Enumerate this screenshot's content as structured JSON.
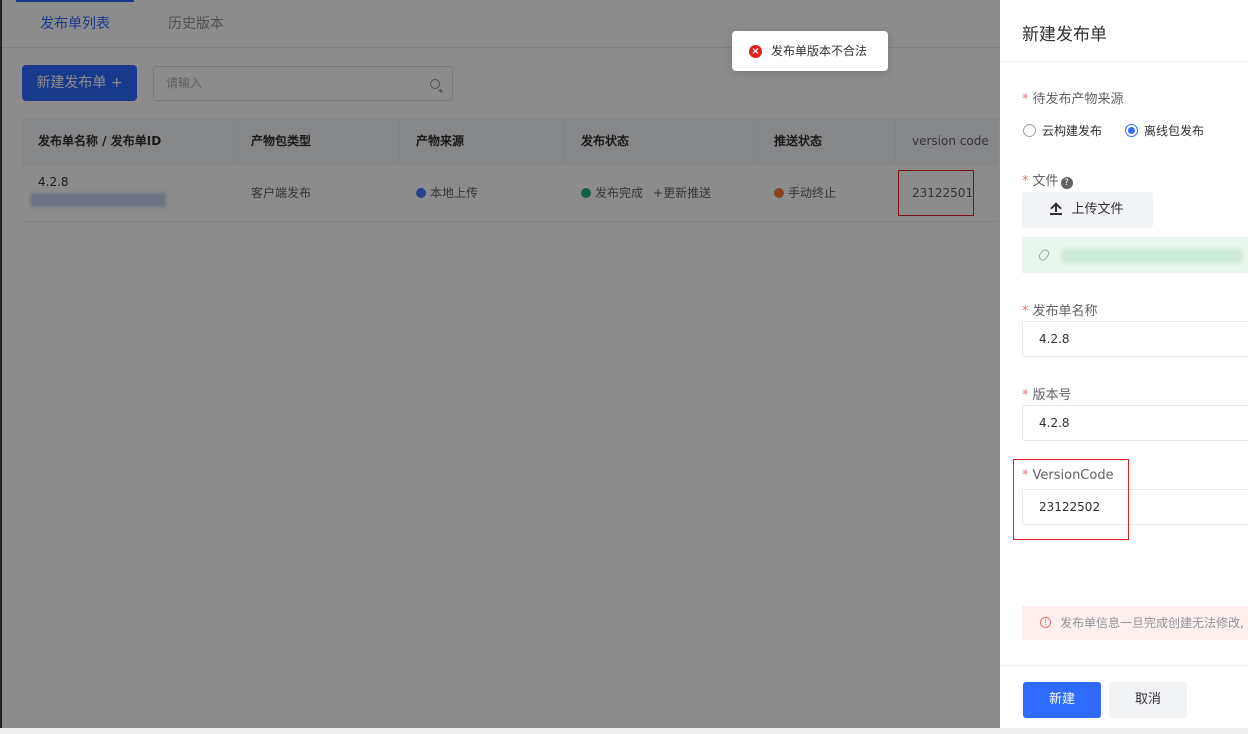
{
  "tabs": [
    {
      "label": "发布单列表",
      "active": true
    },
    {
      "label": "历史版本",
      "active": false
    }
  ],
  "toolbar": {
    "new_button_label": "新建发布单 +",
    "search_placeholder": "请输入"
  },
  "table": {
    "columns": [
      "发布单名称 / 发布单ID",
      "产物包类型",
      "产物来源",
      "发布状态",
      "推送状态",
      "version code"
    ],
    "rows": [
      {
        "name": "4.2.8",
        "package_type": "客户端发布",
        "source": "本地上传",
        "publish_status": "发布完成",
        "update_push": "+更新推送",
        "push_status": "手动终止",
        "version_code": "23122501"
      }
    ]
  },
  "toast": {
    "message": "发布单版本不合法",
    "color": "#e02020"
  },
  "drawer": {
    "title": "新建发布单",
    "source_label": "待发布产物来源",
    "radio_options": [
      "云构建发布",
      "离线包发布"
    ],
    "selected_option": "离线包发布",
    "file_label": "文件",
    "upload_button": "上传文件",
    "name_label": "发布单名称",
    "name_value": "4.2.8",
    "version_label": "版本号",
    "version_value": "4.2.8",
    "versioncode_label": "VersionCode",
    "versioncode_value": "23122502",
    "warning_text": "发布单信息一旦完成创建无法修改,",
    "create_button": "新建",
    "cancel_button": "取消"
  },
  "colors": {
    "primary": "#2f6bff",
    "error": "#e02020",
    "success": "#22b07a",
    "warning": "#ff7b32"
  }
}
